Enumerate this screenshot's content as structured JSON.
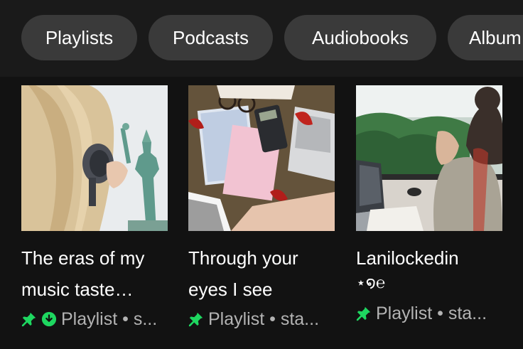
{
  "filters": [
    {
      "label": "Playlists"
    },
    {
      "label": "Podcasts"
    },
    {
      "label": "Audiobooks"
    },
    {
      "label": "Album"
    }
  ],
  "cards": [
    {
      "title_line1": "The eras of my",
      "title_line2": "music taste…",
      "meta": "Playlist • s...",
      "pinned": true,
      "downloaded": true,
      "cover_icon": "statue-of-liberty-headphones-photo"
    },
    {
      "title_line1": "Through your",
      "title_line2": "eyes I see",
      "meta": "Playlist • sta...",
      "pinned": true,
      "downloaded": false,
      "cover_icon": "study-desk-flatlay-photo"
    },
    {
      "title_line1": "Lanilockedin",
      "title_line2": "⋆໑℮",
      "meta": "Playlist • sta...",
      "pinned": true,
      "downloaded": false,
      "cover_icon": "laptop-by-window-photo"
    }
  ],
  "colors": {
    "background": "#121212",
    "chip": "#3a3a3a",
    "accent_green": "#1ed760",
    "secondary_text": "#b3b3b3"
  }
}
